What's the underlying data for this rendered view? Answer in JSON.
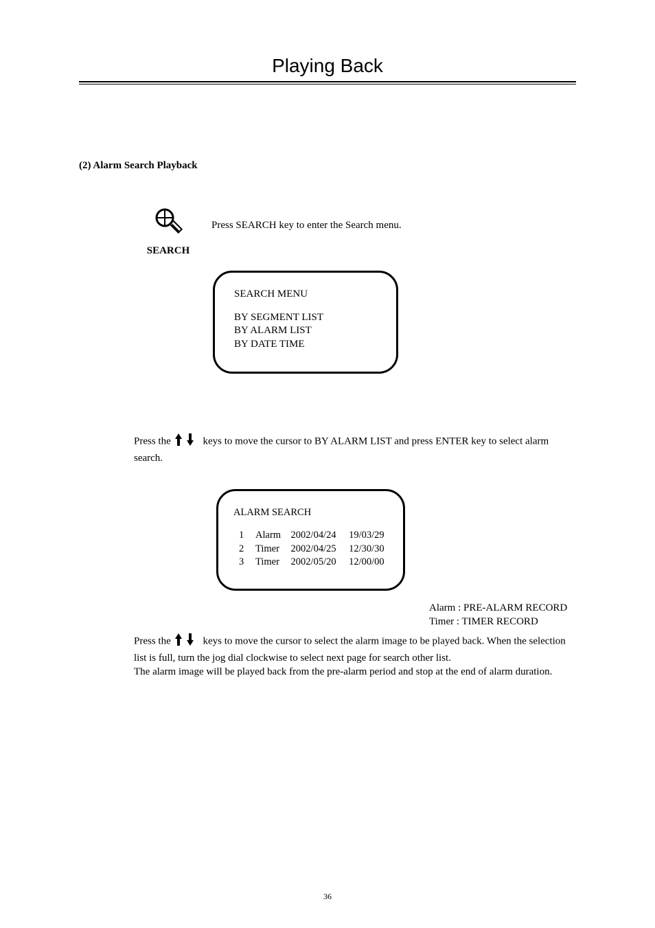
{
  "title": "Playing Back",
  "subheading": "(2) Alarm  Search Playback",
  "search": {
    "label": "SEARCH",
    "text": "Press SEARCH key to enter the Search menu."
  },
  "search_menu": {
    "title": "SEARCH  MENU",
    "items": [
      "BY   SEGMENT  LIST",
      "BY   ALARM   LIST",
      "BY   DATE   TIME"
    ]
  },
  "para1_pre": "Press the",
  "para1_post": "keys to move the cursor to BY ALARM  LIST and press ENTER key to select alarm search.",
  "alarm_search": {
    "title": "ALARM  SEARCH",
    "rows": [
      {
        "n": "1",
        "type": "Alarm",
        "date": "2002/04/24",
        "time": "19/03/29"
      },
      {
        "n": "2",
        "type": "Timer",
        "date": "2002/04/25",
        "time": "12/30/30"
      },
      {
        "n": "3",
        "type": "Timer",
        "date": "2002/05/20",
        "time": "12/00/00"
      }
    ]
  },
  "legend": {
    "line1": "Alarm : PRE-ALARM RECORD",
    "line2": "Timer : TIMER RECORD"
  },
  "para2_pre": "Press the",
  "para2_post": "keys to move the cursor to select the alarm image to be played back. When the selection list is full, turn the jog dial clockwise to select next page for search other list.",
  "para2_line2": "The alarm image will be played back from the pre-alarm period and stop at the end of alarm duration.",
  "page_number": "36"
}
